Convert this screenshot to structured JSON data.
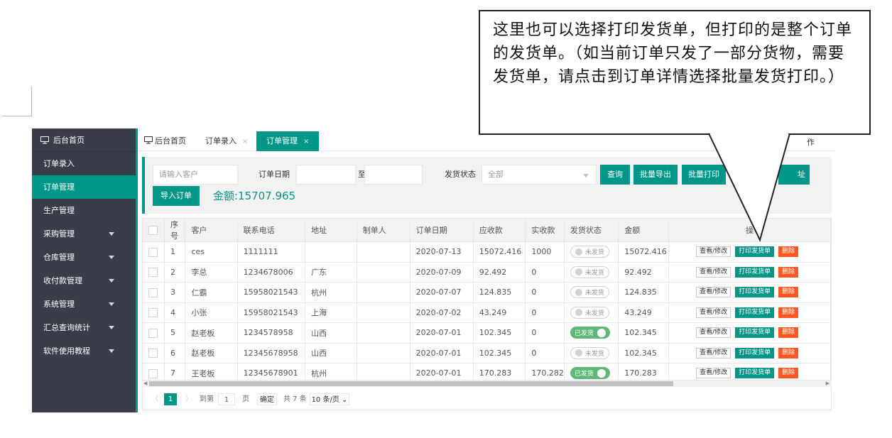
{
  "callout": {
    "text": "这里也可以选择打印发货单，但打印的是整个订单的发货单。（如当前订单只发了一部分货物，需要发货单，请点击到订单详情选择批量发货打印。）"
  },
  "sidebar": {
    "home": "后台首页",
    "items": [
      {
        "label": "订单录入",
        "has_arrow": false
      },
      {
        "label": "订单管理",
        "has_arrow": false,
        "active": true
      },
      {
        "label": "生产管理",
        "has_arrow": false
      },
      {
        "label": "采购管理",
        "has_arrow": true
      },
      {
        "label": "仓库管理",
        "has_arrow": true
      },
      {
        "label": "收付款管理",
        "has_arrow": true
      },
      {
        "label": "系统管理",
        "has_arrow": true
      },
      {
        "label": "汇总查询统计",
        "has_arrow": true
      },
      {
        "label": "软件使用教程",
        "has_arrow": true
      }
    ]
  },
  "tabs": {
    "home": "后台首页",
    "t1": "订单录入",
    "t2": "订单管理",
    "close": "×",
    "ops": "作"
  },
  "filter": {
    "customer_placeholder": "请输入客户",
    "date_label": "订单日期",
    "to": "至",
    "ship_status_label": "发货状态",
    "ship_status_value": "全部",
    "query_btn": "查询",
    "export_btn": "批量导出",
    "print_btn": "批量打印",
    "address_btn_partial": "址",
    "import_btn": "导入订单",
    "amount": "金额:15707.965"
  },
  "table": {
    "headers": [
      "序号",
      "客户",
      "联系电话",
      "地址",
      "制单人",
      "订单日期",
      "应收款",
      "实收款",
      "发货状态",
      "金额",
      "操"
    ],
    "rows": [
      {
        "no": "1",
        "customer": "ces",
        "phone": "1111111",
        "address": "",
        "maker": "",
        "date": "2020-07-13",
        "receivable": "15072.416",
        "received": "1000",
        "status": "未发货",
        "shipped": false,
        "amount": "15072.416"
      },
      {
        "no": "2",
        "customer": "李总",
        "phone": "1234678006",
        "address": "广东",
        "maker": "",
        "date": "2020-07-09",
        "receivable": "92.492",
        "received": "0",
        "status": "未发货",
        "shipped": false,
        "amount": "92.492"
      },
      {
        "no": "3",
        "customer": "仁霸",
        "phone": "15958021543",
        "address": "杭州",
        "maker": "",
        "date": "2020-07-07",
        "receivable": "124.835",
        "received": "0",
        "status": "未发货",
        "shipped": false,
        "amount": "124.835"
      },
      {
        "no": "4",
        "customer": "小张",
        "phone": "15958021543",
        "address": "上海",
        "maker": "",
        "date": "2020-07-02",
        "receivable": "43.249",
        "received": "0",
        "status": "未发货",
        "shipped": false,
        "amount": "43.249"
      },
      {
        "no": "5",
        "customer": "赵老板",
        "phone": "1234578958",
        "address": "山西",
        "maker": "",
        "date": "2020-07-01",
        "receivable": "102.345",
        "received": "0",
        "status": "已发货",
        "shipped": true,
        "amount": "102.345"
      },
      {
        "no": "6",
        "customer": "赵老板",
        "phone": "12345678958",
        "address": "山西",
        "maker": "",
        "date": "2020-07-01",
        "receivable": "102.345",
        "received": "0",
        "status": "未发货",
        "shipped": false,
        "amount": "102.345"
      },
      {
        "no": "7",
        "customer": "王老板",
        "phone": "12345678901",
        "address": "杭州",
        "maker": "",
        "date": "2020-07-01",
        "receivable": "170.283",
        "received": "170.282",
        "status": "已发货",
        "shipped": true,
        "amount": "170.283"
      }
    ],
    "ops": {
      "view": "查看/修改",
      "print": "打印发货单",
      "delete": "删除"
    }
  },
  "pager": {
    "prev": "〈",
    "current": "1",
    "next": "〉",
    "goto": "到第",
    "page_value": "1",
    "page_unit": "页",
    "confirm": "确定",
    "total": "共 7 条",
    "per_page": "10 条/页"
  }
}
